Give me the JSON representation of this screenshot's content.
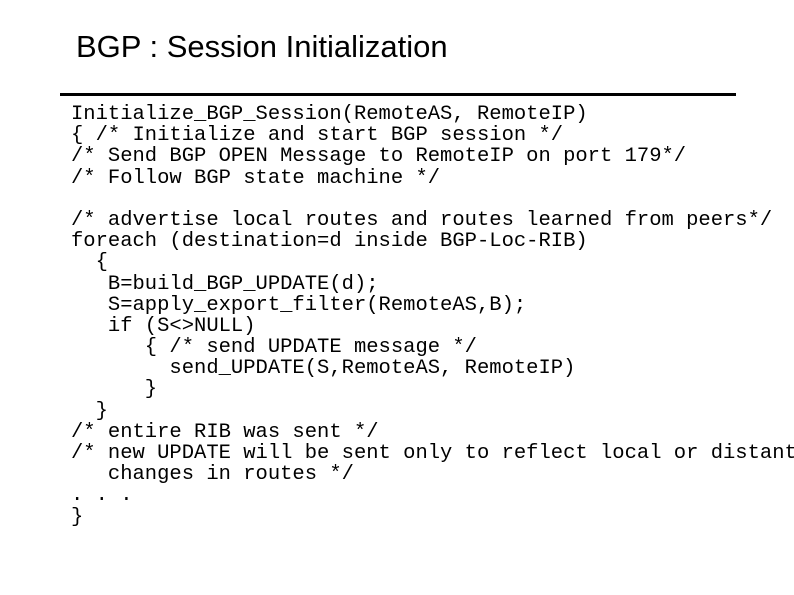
{
  "slide": {
    "title": "BGP : Session Initialization",
    "background_color": "#ffffff",
    "text_color": "#000000",
    "rule_color": "#000000"
  },
  "code": {
    "lines": [
      "Initialize_BGP_Session(RemoteAS, RemoteIP)",
      "{ /* Initialize and start BGP session */",
      "/* Send BGP OPEN Message to RemoteIP on port 179*/",
      "/* Follow BGP state machine */",
      "",
      "/* advertise local routes and routes learned from peers*/",
      "foreach (destination=d inside BGP-Loc-RIB)",
      "  {",
      "   B=build_BGP_UPDATE(d);",
      "   S=apply_export_filter(RemoteAS,B);",
      "   if (S<>NULL)",
      "      { /* send UPDATE message */",
      "        send_UPDATE(S,RemoteAS, RemoteIP)",
      "      }",
      "  }",
      "/* entire RIB was sent */",
      "/* new UPDATE will be sent only to reflect local or distant",
      "   changes in routes */",
      ". . .",
      "}"
    ]
  }
}
